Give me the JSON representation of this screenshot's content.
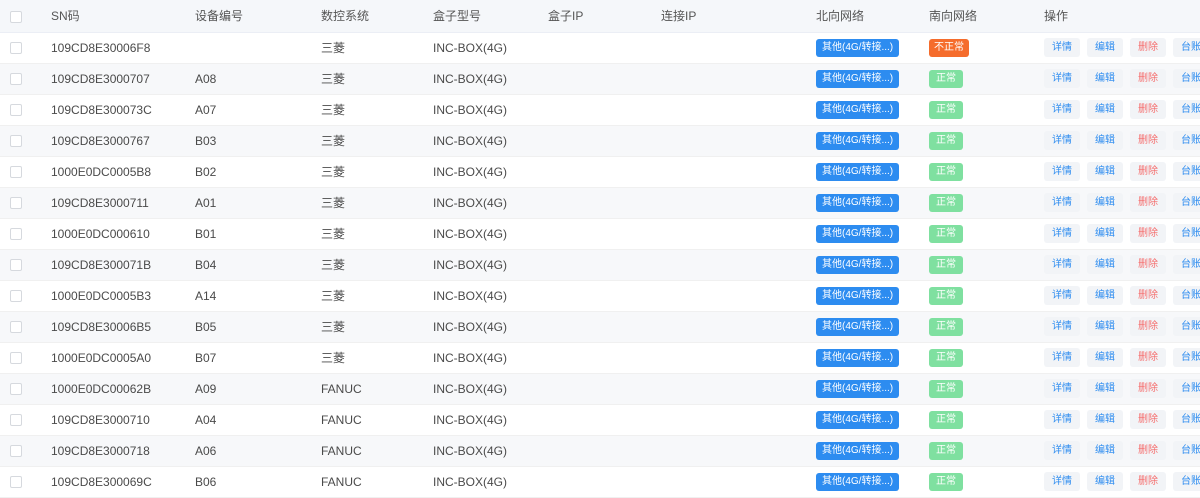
{
  "columns": {
    "sn": "SN码",
    "device_no": "设备编号",
    "cnc": "数控系统",
    "box_model": "盒子型号",
    "box_ip": "盒子IP",
    "conn_ip": "连接IP",
    "north": "北向网络",
    "south": "南向网络",
    "ops": "操作"
  },
  "actions": {
    "detail": "详情",
    "edit": "编辑",
    "delete": "删除",
    "ledger": "台账"
  },
  "status_colors": {
    "north": "#2d8cf0",
    "ok": "#7fe0a0",
    "bad": "#f56c2c"
  },
  "rows": [
    {
      "sn": "109CD8E30006F8",
      "device_no": "",
      "cnc": "三菱",
      "box_model": "INC-BOX(4G)",
      "box_ip": "",
      "conn_ip": "",
      "north": "其他(4G/转接...)",
      "south": "不正常",
      "south_ok": false
    },
    {
      "sn": "109CD8E3000707",
      "device_no": "A08",
      "cnc": "三菱",
      "box_model": "INC-BOX(4G)",
      "box_ip": "",
      "conn_ip": "",
      "north": "其他(4G/转接...)",
      "south": "正常",
      "south_ok": true
    },
    {
      "sn": "109CD8E300073C",
      "device_no": "A07",
      "cnc": "三菱",
      "box_model": "INC-BOX(4G)",
      "box_ip": "",
      "conn_ip": "",
      "north": "其他(4G/转接...)",
      "south": "正常",
      "south_ok": true
    },
    {
      "sn": "109CD8E3000767",
      "device_no": "B03",
      "cnc": "三菱",
      "box_model": "INC-BOX(4G)",
      "box_ip": "",
      "conn_ip": "",
      "north": "其他(4G/转接...)",
      "south": "正常",
      "south_ok": true
    },
    {
      "sn": "1000E0DC0005B8",
      "device_no": "B02",
      "cnc": "三菱",
      "box_model": "INC-BOX(4G)",
      "box_ip": "",
      "conn_ip": "",
      "north": "其他(4G/转接...)",
      "south": "正常",
      "south_ok": true
    },
    {
      "sn": "109CD8E3000711",
      "device_no": "A01",
      "cnc": "三菱",
      "box_model": "INC-BOX(4G)",
      "box_ip": "",
      "conn_ip": "",
      "north": "其他(4G/转接...)",
      "south": "正常",
      "south_ok": true
    },
    {
      "sn": "1000E0DC000610",
      "device_no": "B01",
      "cnc": "三菱",
      "box_model": "INC-BOX(4G)",
      "box_ip": "",
      "conn_ip": "",
      "north": "其他(4G/转接...)",
      "south": "正常",
      "south_ok": true
    },
    {
      "sn": "109CD8E300071B",
      "device_no": "B04",
      "cnc": "三菱",
      "box_model": "INC-BOX(4G)",
      "box_ip": "",
      "conn_ip": "",
      "north": "其他(4G/转接...)",
      "south": "正常",
      "south_ok": true
    },
    {
      "sn": "1000E0DC0005B3",
      "device_no": "A14",
      "cnc": "三菱",
      "box_model": "INC-BOX(4G)",
      "box_ip": "",
      "conn_ip": "",
      "north": "其他(4G/转接...)",
      "south": "正常",
      "south_ok": true
    },
    {
      "sn": "109CD8E30006B5",
      "device_no": "B05",
      "cnc": "三菱",
      "box_model": "INC-BOX(4G)",
      "box_ip": "",
      "conn_ip": "",
      "north": "其他(4G/转接...)",
      "south": "正常",
      "south_ok": true
    },
    {
      "sn": "1000E0DC0005A0",
      "device_no": "B07",
      "cnc": "三菱",
      "box_model": "INC-BOX(4G)",
      "box_ip": "",
      "conn_ip": "",
      "north": "其他(4G/转接...)",
      "south": "正常",
      "south_ok": true
    },
    {
      "sn": "1000E0DC00062B",
      "device_no": "A09",
      "cnc": "FANUC",
      "box_model": "INC-BOX(4G)",
      "box_ip": "",
      "conn_ip": "",
      "north": "其他(4G/转接...)",
      "south": "正常",
      "south_ok": true
    },
    {
      "sn": "109CD8E3000710",
      "device_no": "A04",
      "cnc": "FANUC",
      "box_model": "INC-BOX(4G)",
      "box_ip": "",
      "conn_ip": "",
      "north": "其他(4G/转接...)",
      "south": "正常",
      "south_ok": true
    },
    {
      "sn": "109CD8E3000718",
      "device_no": "A06",
      "cnc": "FANUC",
      "box_model": "INC-BOX(4G)",
      "box_ip": "",
      "conn_ip": "",
      "north": "其他(4G/转接...)",
      "south": "正常",
      "south_ok": true
    },
    {
      "sn": "109CD8E300069C",
      "device_no": "B06",
      "cnc": "FANUC",
      "box_model": "INC-BOX(4G)",
      "box_ip": "",
      "conn_ip": "",
      "north": "其他(4G/转接...)",
      "south": "正常",
      "south_ok": true
    }
  ]
}
